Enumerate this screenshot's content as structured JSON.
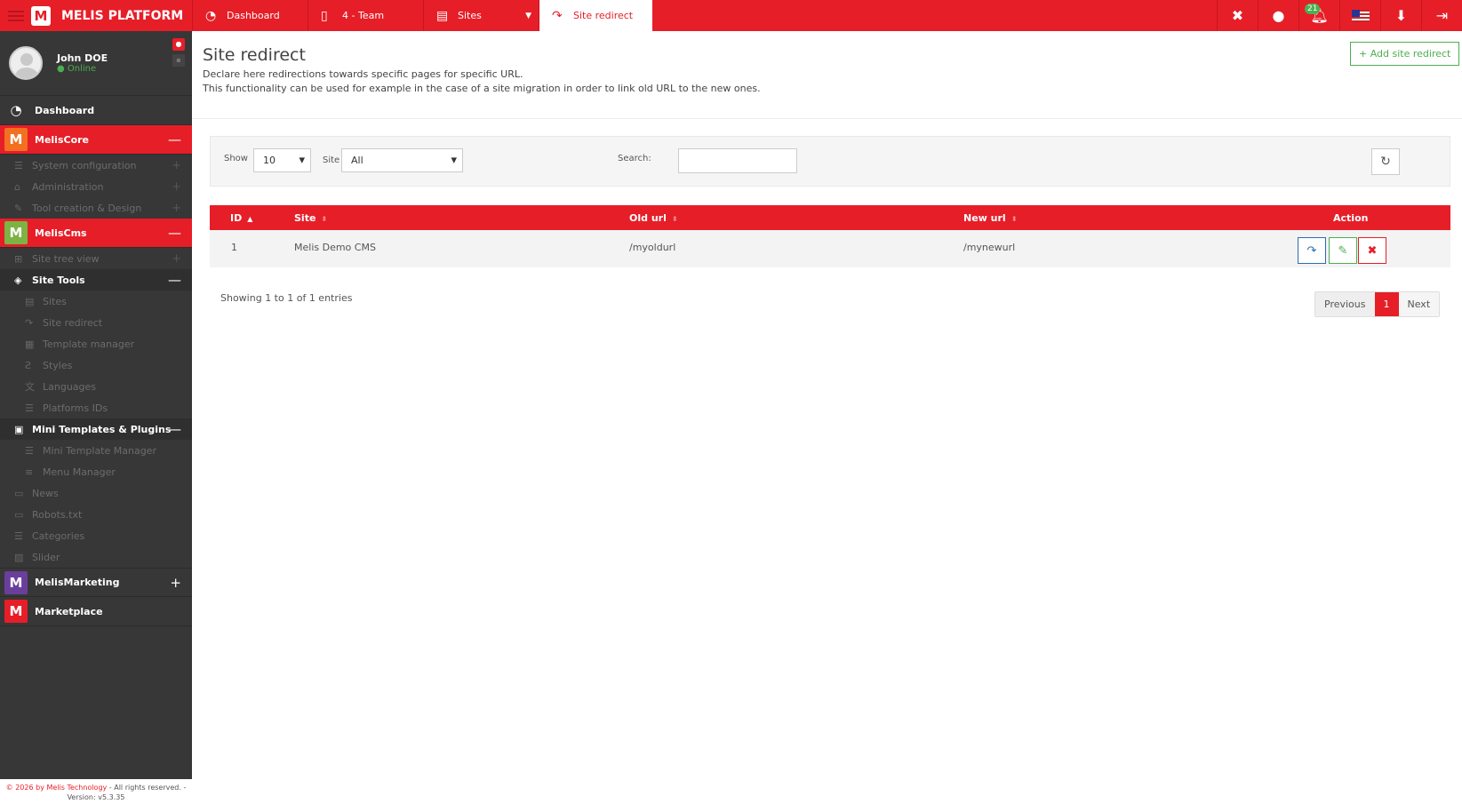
{
  "topbar": {
    "brand": "MELIS PLATFORM",
    "logo_letter": "M",
    "tabs": [
      {
        "label": "Dashboard",
        "icon": "dashboard-icon"
      },
      {
        "label": "4 - Team",
        "icon": "page-icon"
      },
      {
        "label": "Sites",
        "icon": "book-icon"
      },
      {
        "label": "Site redirect",
        "icon": "share-icon"
      }
    ],
    "notification_count": "21"
  },
  "sidebar": {
    "user": {
      "name": "John DOE",
      "status": "Online"
    },
    "dashboard": "Dashboard",
    "meliscore": {
      "label": "MelisCore",
      "items": [
        "System configuration",
        "Administration",
        "Tool creation & Design"
      ]
    },
    "meliscms": {
      "label": "MelisCms",
      "site_tree": "Site tree view",
      "site_tools": {
        "label": "Site Tools",
        "items": [
          "Sites",
          "Site redirect",
          "Template manager",
          "Styles",
          "Languages",
          "Platforms IDs"
        ]
      },
      "mini_templates": {
        "label": "Mini Templates & Plugins",
        "items": [
          "Mini Template Manager",
          "Menu Manager"
        ]
      },
      "others": [
        "News",
        "Robots.txt",
        "Categories",
        "Slider"
      ]
    },
    "melismarketing": "MelisMarketing",
    "marketplace": "Marketplace",
    "footer": {
      "copyright": "© 2026 by Melis Technology",
      "rights": " - All rights reserved. -",
      "version": "Version: v5.3.35"
    }
  },
  "page": {
    "title": "Site redirect",
    "desc1": "Declare here redirections towards specific pages for specific URL.",
    "desc2": "This functionality can be used for example in the case of a site migration in order to link old URL to the new ones.",
    "add_button": "+ Add site redirect"
  },
  "filters": {
    "show_label": "Show",
    "show_value": "10",
    "site_label": "Site",
    "site_value": "All",
    "search_label": "Search:"
  },
  "table": {
    "columns": [
      "ID",
      "Site",
      "Old url",
      "New url",
      "Action"
    ],
    "rows": [
      {
        "id": "1",
        "site": "Melis Demo CMS",
        "old_url": "/myoldurl",
        "new_url": "/mynewurl"
      }
    ]
  },
  "pagination": {
    "info": "Showing 1 to 1 of 1 entries",
    "previous": "Previous",
    "current": "1",
    "next": "Next"
  },
  "colors": {
    "brand": "#e61e28",
    "success": "#4caf50",
    "sidebar": "#373737"
  }
}
